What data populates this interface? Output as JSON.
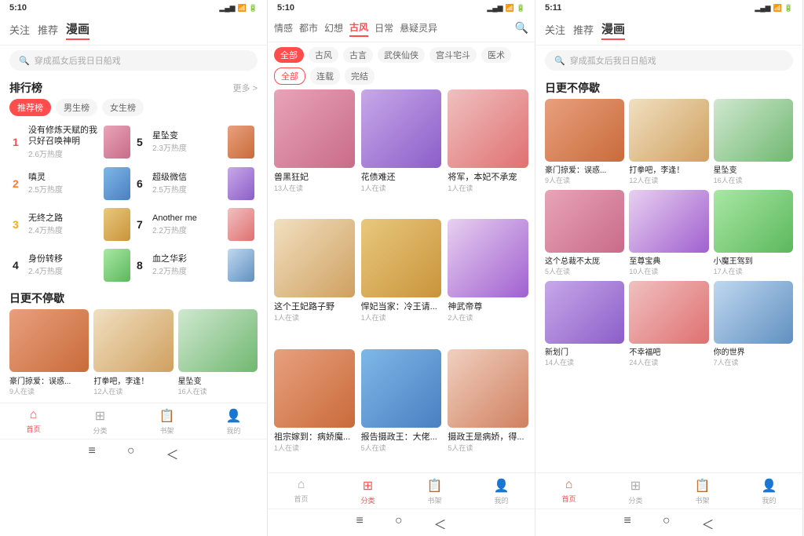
{
  "panel1": {
    "statusBar": {
      "time": "5:10",
      "icons": "信号 WiFi 电池"
    },
    "tabs": [
      "关注",
      "推荐",
      "漫画"
    ],
    "activeTab": "漫画",
    "search": {
      "placeholder": "穿成孤女后我日日船戏"
    },
    "ranking": {
      "title": "排行榜",
      "more": "更多 >",
      "tabs": [
        "推荐榜",
        "男生榜",
        "女生榜"
      ],
      "activeTab": "推荐榜",
      "items": [
        {
          "rank": "1",
          "name": "没有修炼天赋的我只好召唤神明",
          "heat": "2.6万热度",
          "color": "c1"
        },
        {
          "rank": "2",
          "name": "嗔灵",
          "heat": "2.5万热度",
          "color": "c2"
        },
        {
          "rank": "3",
          "name": "无终之路",
          "heat": "2.4万热度",
          "color": "c3"
        },
        {
          "rank": "4",
          "name": "身份转移",
          "heat": "2.4万热度",
          "color": "c4"
        },
        {
          "rank": "5",
          "name": "星坠变",
          "heat": "2.3万热度",
          "color": "c5"
        },
        {
          "rank": "6",
          "name": "超级微信",
          "heat": "2.5万热度",
          "color": "c6"
        },
        {
          "rank": "7",
          "name": "Another me",
          "heat": "2.2万热度",
          "color": "c7"
        },
        {
          "rank": "8",
          "name": "血之华彩",
          "heat": "2.2万热度",
          "color": "c8"
        }
      ]
    },
    "daily": {
      "title": "日更不停歇",
      "items": [
        {
          "name": "豪门掠爱：误惑...",
          "readers": "9人在读",
          "color": "c5"
        },
        {
          "name": "打拳吧，李逢！",
          "readers": "12人在读",
          "color": "c9"
        },
        {
          "name": "星坠变",
          "readers": "16人在读",
          "color": "c10"
        }
      ]
    },
    "bottomNav": [
      {
        "icon": "🏠",
        "label": "首页",
        "active": true
      },
      {
        "icon": "⊞",
        "label": "分类",
        "active": false
      },
      {
        "icon": "📚",
        "label": "书架",
        "active": false
      },
      {
        "icon": "👤",
        "label": "我的",
        "active": false
      }
    ],
    "androidNav": [
      "≡",
      "○",
      "＜"
    ]
  },
  "panel2": {
    "statusBar": {
      "time": "5:10",
      "icons": "信号 WiFi 电池"
    },
    "categoryTabs": [
      "情感",
      "都市",
      "幻想",
      "古风",
      "日常",
      "悬疑灵异"
    ],
    "activeTab": "古风",
    "filters1": [
      "全部",
      "古风",
      "古言",
      "武侠仙侠",
      "宫斗宅斗",
      "医术"
    ],
    "activeFilter1": "全部",
    "filters2": [
      "全部",
      "连载",
      "完结"
    ],
    "activeFilter2": "全部",
    "mangas": [
      {
        "name": "兽黑狂妃",
        "readers": "13人在读",
        "color": "c1"
      },
      {
        "name": "花债难还",
        "readers": "1人在读",
        "color": "c6"
      },
      {
        "name": "将军，本妃不承宠",
        "readers": "1人在读",
        "color": "c7"
      },
      {
        "name": "这个王妃路子野",
        "readers": "1人在读",
        "color": "c9"
      },
      {
        "name": "悍妃当家：冷王请...",
        "readers": "1人在读",
        "color": "c3"
      },
      {
        "name": "神武帝尊",
        "readers": "2人在读",
        "color": "c11"
      },
      {
        "name": "祖宗嫁到：病娇魔...",
        "readers": "1人在读",
        "color": "c5"
      },
      {
        "name": "报告摄政王：大佬...",
        "readers": "5人在读",
        "color": "c2"
      },
      {
        "name": "摄政王是病娇，得...",
        "readers": "5人在读",
        "color": "c12"
      }
    ],
    "bottomNav": [
      {
        "icon": "🏠",
        "label": "首页",
        "active": false
      },
      {
        "icon": "⊞",
        "label": "分类",
        "active": true
      },
      {
        "icon": "📚",
        "label": "书架",
        "active": false
      },
      {
        "icon": "👤",
        "label": "我的",
        "active": false
      }
    ],
    "androidNav": [
      "≡",
      "○",
      "＜"
    ]
  },
  "panel3": {
    "statusBar": {
      "time": "5:11",
      "icons": "信号 WiFi 电池"
    },
    "tabs": [
      "关注",
      "推荐",
      "漫画"
    ],
    "activeTab": "漫画",
    "search": {
      "placeholder": "穿成孤女后我日日船戏"
    },
    "daily": {
      "title": "日更不停歇",
      "items": [
        {
          "name": "豪门掠爱：误惑...",
          "readers": "9人在读",
          "color": "c5"
        },
        {
          "name": "打拳吧，李逢！",
          "readers": "12人在读",
          "color": "c9"
        },
        {
          "name": "星坠变",
          "readers": "16人在读",
          "color": "c10"
        },
        {
          "name": "这个总裁不太厐",
          "readers": "5人在读",
          "color": "c1"
        },
        {
          "name": "至尊宝典",
          "readers": "10人在读",
          "color": "c11"
        },
        {
          "name": "小魔王驾到",
          "readers": "17人在读",
          "color": "c4"
        },
        {
          "name": "新划门",
          "readers": "14人在读",
          "color": "c6"
        },
        {
          "name": "不幸福吧",
          "readers": "24人在读",
          "color": "c7"
        },
        {
          "name": "你的世界",
          "readers": "7人在读",
          "color": "c8"
        }
      ]
    },
    "bottomNav": [
      {
        "icon": "🏠",
        "label": "首页",
        "active": true
      },
      {
        "icon": "⊞",
        "label": "分类",
        "active": false
      },
      {
        "icon": "📚",
        "label": "书架",
        "active": false
      },
      {
        "icon": "👤",
        "label": "我的",
        "active": false
      }
    ],
    "androidNav": [
      "≡",
      "○",
      "＜"
    ]
  }
}
